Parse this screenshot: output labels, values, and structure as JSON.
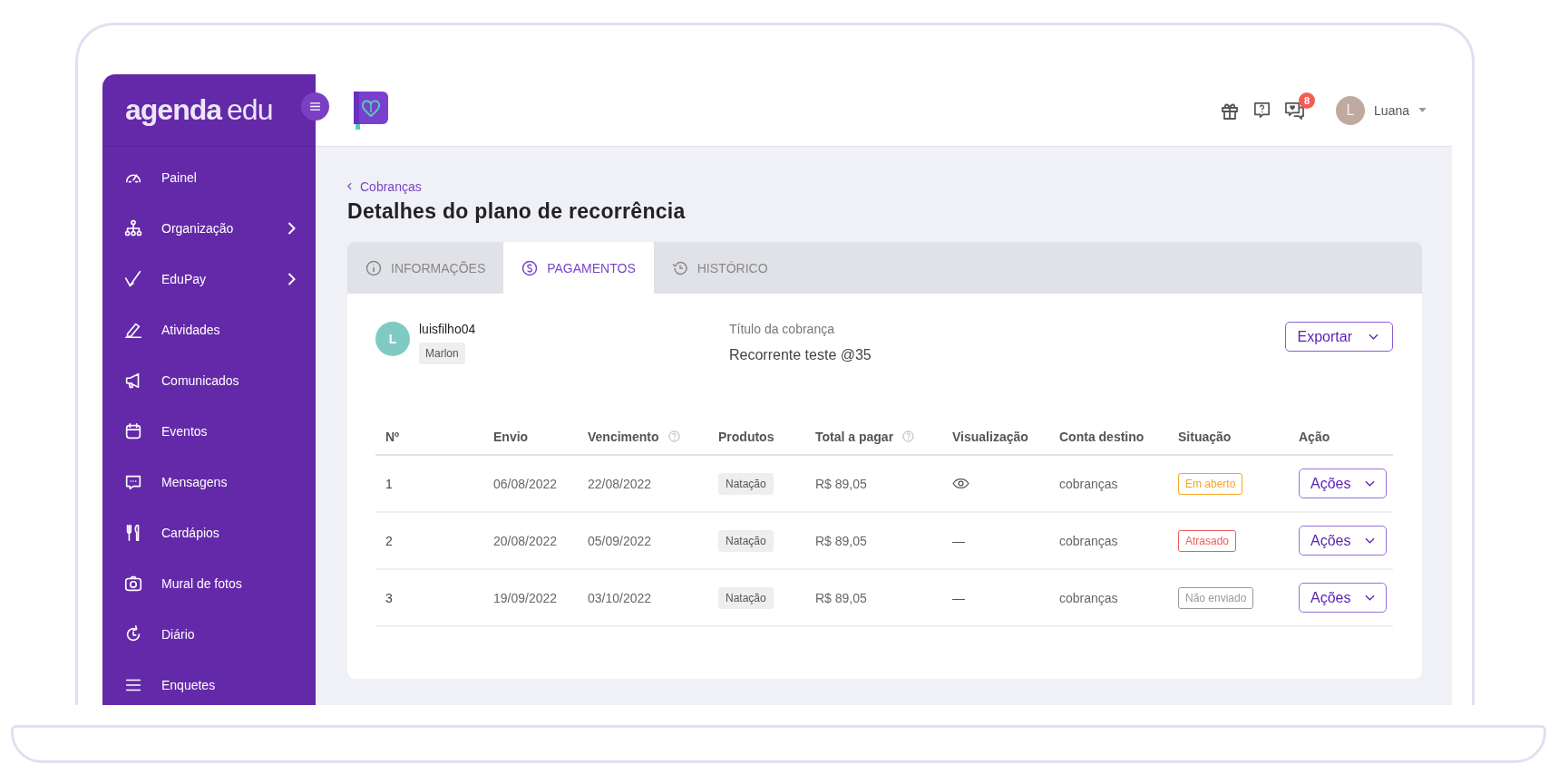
{
  "sidebar": {
    "logo": {
      "primary": "agenda",
      "secondary": "edu"
    },
    "items": [
      {
        "label": "Painel",
        "has_submenu": false
      },
      {
        "label": "Organização",
        "has_submenu": true
      },
      {
        "label": "EduPay",
        "has_submenu": true
      },
      {
        "label": "Atividades",
        "has_submenu": false
      },
      {
        "label": "Comunicados",
        "has_submenu": false
      },
      {
        "label": "Eventos",
        "has_submenu": false
      },
      {
        "label": "Mensagens",
        "has_submenu": false
      },
      {
        "label": "Cardápios",
        "has_submenu": false
      },
      {
        "label": "Mural de fotos",
        "has_submenu": false
      },
      {
        "label": "Diário",
        "has_submenu": false
      },
      {
        "label": "Enquetes",
        "has_submenu": false
      }
    ]
  },
  "header": {
    "notification_count": "8",
    "user": {
      "initial": "L",
      "name": "Luana"
    }
  },
  "breadcrumb": "Cobranças",
  "title": "Detalhes do plano de recorrência",
  "tabs": [
    {
      "label": "INFORMAÇÕES",
      "selected": false
    },
    {
      "label": "PAGAMENTOS",
      "selected": true
    },
    {
      "label": "HISTÓRICO",
      "selected": false
    }
  ],
  "student": {
    "initial": "L",
    "username": "luisfilho04",
    "tag": "Marlon"
  },
  "charge_title": {
    "label": "Título da cobrança",
    "value": "Recorrente teste @35"
  },
  "export_button": "Exportar",
  "table": {
    "columns": [
      {
        "label": "Nº",
        "help": false
      },
      {
        "label": "Envio",
        "help": false
      },
      {
        "label": "Vencimento",
        "help": true
      },
      {
        "label": "Produtos",
        "help": false
      },
      {
        "label": "Total a pagar",
        "help": true
      },
      {
        "label": "Visualização",
        "help": false
      },
      {
        "label": "Conta destino",
        "help": false
      },
      {
        "label": "Situação",
        "help": false
      },
      {
        "label": "Ação",
        "help": false
      }
    ],
    "rows": [
      {
        "number": "1",
        "sent": "06/08/2022",
        "due": "22/08/2022",
        "product": "Natação",
        "total": "R$ 89,05",
        "visualization": {
          "kind": "icon"
        },
        "account": "cobranças",
        "status": {
          "label": "Em aberto",
          "color": "#f5a623"
        },
        "action": "Ações"
      },
      {
        "number": "2",
        "sent": "20/08/2022",
        "due": "05/09/2022",
        "product": "Natação",
        "total": "R$ 89,05",
        "visualization": {
          "kind": "text",
          "text": "—"
        },
        "account": "cobranças",
        "status": {
          "label": "Atrasado",
          "color": "#f05a5a"
        },
        "action": "Ações"
      },
      {
        "number": "3",
        "sent": "19/09/2022",
        "due": "03/10/2022",
        "product": "Natação",
        "total": "R$ 89,05",
        "visualization": {
          "kind": "text",
          "text": "—"
        },
        "account": "cobranças",
        "status": {
          "label": "Não enviado",
          "color": "#9a9a9a"
        },
        "action": "Ações"
      }
    ]
  }
}
